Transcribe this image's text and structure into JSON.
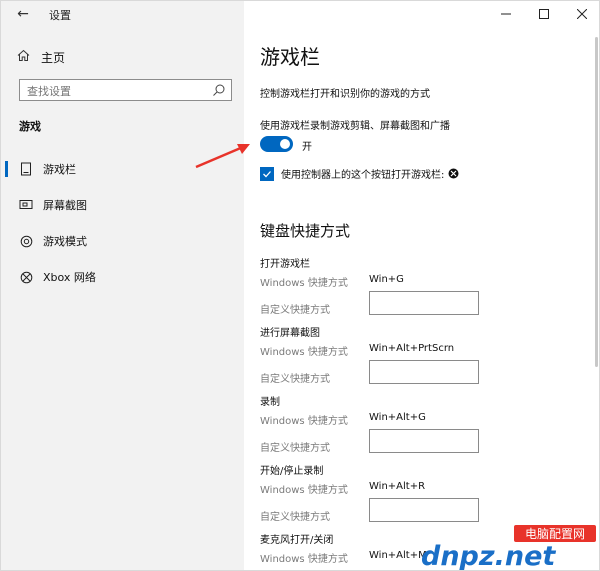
{
  "window": {
    "title": "设置",
    "minimize": "—",
    "maximize": "☐",
    "close": "✕"
  },
  "sidebar": {
    "back_glyph": "←",
    "home_label": "主页",
    "home_icon": "home-icon",
    "search_placeholder": "查找设置",
    "section": "游戏",
    "items": [
      {
        "label": "游戏栏",
        "icon": "game-bar-icon",
        "glyph": "▯",
        "selected": true
      },
      {
        "label": "屏幕截图",
        "icon": "screenshot-icon",
        "glyph": "⊡",
        "selected": false
      },
      {
        "label": "游戏模式",
        "icon": "game-mode-icon",
        "glyph": "◉",
        "selected": false
      },
      {
        "label": "Xbox 网络",
        "icon": "xbox-icon",
        "glyph": "⊗",
        "selected": false
      }
    ]
  },
  "main": {
    "title": "游戏栏",
    "description": "控制游戏栏打开和识别你的游戏的方式",
    "toggle_label": "使用游戏栏录制游戏剪辑、屏幕截图和广播",
    "toggle_state": "开",
    "checkbox_label": "使用控制器上的这个按钮打开游戏栏:",
    "keyboard_title": "键盘快捷方式",
    "windows_shortcut_label": "Windows 快捷方式",
    "custom_shortcut_label": "自定义快捷方式",
    "shortcuts": [
      {
        "name": "打开游戏栏",
        "windows": "Win+G"
      },
      {
        "name": "进行屏幕截图",
        "windows": "Win+Alt+PrtScrn"
      },
      {
        "name": "录制",
        "windows": "Win+Alt+G"
      },
      {
        "name": "开始/停止录制",
        "windows": "Win+Alt+R"
      },
      {
        "name": "麦克风打开/关闭",
        "windows": "Win+Alt+M"
      }
    ]
  },
  "colors": {
    "accent": "#0067c0",
    "sidebar_bg": "#f2f2f2",
    "annotation_arrow": "#e8332a"
  },
  "watermark": {
    "brand_cn": "电脑配置网",
    "brand_domain": "dnpz.net"
  }
}
